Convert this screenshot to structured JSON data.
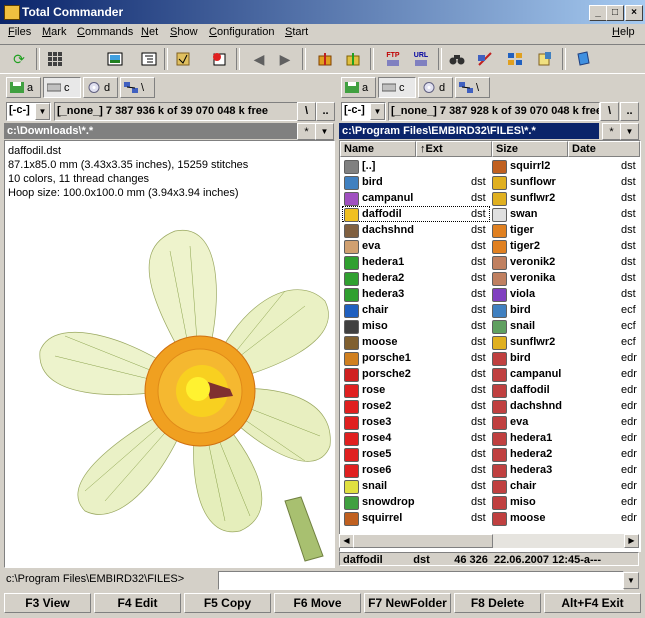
{
  "window": {
    "title": "Total Commander",
    "controls": {
      "minimize": "_",
      "maximize": "□",
      "close": "×"
    }
  },
  "menu": {
    "items": [
      "Files",
      "Mark",
      "Commands",
      "Net",
      "Show",
      "Configuration",
      "Start"
    ],
    "help": "Help"
  },
  "toolbar": {
    "icons": [
      "refresh-icon",
      "thumbnails-icon",
      "image-icon",
      "tree-icon",
      "invert-selection-icon",
      "compare-icon",
      "back-icon",
      "forward-icon",
      "pack-icon",
      "unpack-icon",
      "ftp-icon",
      "url-icon",
      "find-icon",
      "rename-icon",
      "sync-icon",
      "edit-icon",
      "notes-icon"
    ],
    "ftp_label": "FTP",
    "url_label": "URL"
  },
  "left": {
    "drives": [
      "a",
      "c",
      "d",
      "\\"
    ],
    "combo": "[-c-]",
    "free": "[_none_]  7 387 936 k of 39 070 048 k free",
    "root_btn": "\\",
    "up_btn": "..",
    "path": "c:\\Downloads\\*.*",
    "star": "*",
    "viewer": {
      "lines": [
        "daffodil.dst",
        "87.1x85.0 mm (3.43x3.35 inches), 15259 stitches",
        "10 colors, 11 thread changes",
        "Hoop size: 100.0x100.0 mm (3.94x3.94 inches)"
      ]
    }
  },
  "right": {
    "drives": [
      "a",
      "c",
      "d",
      "\\"
    ],
    "combo": "[-c-]",
    "free": "[_none_]  7 387 928 k of 39 070 048 k free",
    "root_btn": "\\",
    "up_btn": "..",
    "path": "c:\\Program Files\\EMBIRD32\\FILES\\*.*",
    "star": "*",
    "columns": {
      "name": "Name",
      "ext": "↑Ext",
      "size": "Size",
      "date": "Date"
    },
    "col1": [
      {
        "name": "[..]",
        "ext": "",
        "color": "#808080"
      },
      {
        "name": "bird",
        "ext": "dst",
        "color": "#4080c0"
      },
      {
        "name": "campanul",
        "ext": "dst",
        "color": "#a050c0"
      },
      {
        "name": "daffodil",
        "ext": "dst",
        "color": "#f0c020"
      },
      {
        "name": "dachshnd",
        "ext": "dst",
        "color": "#806040"
      },
      {
        "name": "eva",
        "ext": "dst",
        "color": "#d0a070"
      },
      {
        "name": "hedera1",
        "ext": "dst",
        "color": "#30a030"
      },
      {
        "name": "hedera2",
        "ext": "dst",
        "color": "#30a030"
      },
      {
        "name": "hedera3",
        "ext": "dst",
        "color": "#30a030"
      },
      {
        "name": "chair",
        "ext": "dst",
        "color": "#2060c0"
      },
      {
        "name": "miso",
        "ext": "dst",
        "color": "#404040"
      },
      {
        "name": "moose",
        "ext": "dst",
        "color": "#806030"
      },
      {
        "name": "porsche1",
        "ext": "dst",
        "color": "#d08020"
      },
      {
        "name": "porsche2",
        "ext": "dst",
        "color": "#d02020"
      },
      {
        "name": "rose",
        "ext": "dst",
        "color": "#e02020"
      },
      {
        "name": "rose2",
        "ext": "dst",
        "color": "#e02020"
      },
      {
        "name": "rose3",
        "ext": "dst",
        "color": "#e02020"
      },
      {
        "name": "rose4",
        "ext": "dst",
        "color": "#e02020"
      },
      {
        "name": "rose5",
        "ext": "dst",
        "color": "#e02020"
      },
      {
        "name": "rose6",
        "ext": "dst",
        "color": "#e02020"
      },
      {
        "name": "snail",
        "ext": "dst",
        "color": "#e0e040"
      },
      {
        "name": "snowdrop",
        "ext": "dst",
        "color": "#40a040"
      },
      {
        "name": "squirrel",
        "ext": "dst",
        "color": "#c06020"
      }
    ],
    "col2": [
      {
        "name": "squirrl2",
        "ext": "dst",
        "color": "#c06020"
      },
      {
        "name": "sunflowr",
        "ext": "dst",
        "color": "#e0b020"
      },
      {
        "name": "sunflwr2",
        "ext": "dst",
        "color": "#e0b020"
      },
      {
        "name": "swan",
        "ext": "dst",
        "color": "#e0e0e0"
      },
      {
        "name": "tiger",
        "ext": "dst",
        "color": "#e08020"
      },
      {
        "name": "tiger2",
        "ext": "dst",
        "color": "#e08020"
      },
      {
        "name": "veronik2",
        "ext": "dst",
        "color": "#c08060"
      },
      {
        "name": "veronika",
        "ext": "dst",
        "color": "#c08060"
      },
      {
        "name": "viola",
        "ext": "dst",
        "color": "#8040c0"
      },
      {
        "name": "bird",
        "ext": "ecf",
        "color": "#4080c0"
      },
      {
        "name": "snail",
        "ext": "ecf",
        "color": "#60a060"
      },
      {
        "name": "sunflwr2",
        "ext": "ecf",
        "color": "#e0b020"
      },
      {
        "name": "bird",
        "ext": "edr",
        "color": "#c04040"
      },
      {
        "name": "campanul",
        "ext": "edr",
        "color": "#c04040"
      },
      {
        "name": "daffodil",
        "ext": "edr",
        "color": "#c04040"
      },
      {
        "name": "dachshnd",
        "ext": "edr",
        "color": "#c04040"
      },
      {
        "name": "eva",
        "ext": "edr",
        "color": "#c04040"
      },
      {
        "name": "hedera1",
        "ext": "edr",
        "color": "#c04040"
      },
      {
        "name": "hedera2",
        "ext": "edr",
        "color": "#c04040"
      },
      {
        "name": "hedera3",
        "ext": "edr",
        "color": "#c04040"
      },
      {
        "name": "chair",
        "ext": "edr",
        "color": "#c04040"
      },
      {
        "name": "miso",
        "ext": "edr",
        "color": "#c04040"
      },
      {
        "name": "moose",
        "ext": "edr",
        "color": "#c04040"
      }
    ],
    "status": "daffodil          dst        46 326  22.06.2007 12:45-a---"
  },
  "cmdline": {
    "label": "c:\\Program Files\\EMBIRD32\\FILES>",
    "value": ""
  },
  "fkeys": [
    "F3 View",
    "F4 Edit",
    "F5 Copy",
    "F6 Move",
    "F7 NewFolder",
    "F8 Delete",
    "Alt+F4 Exit"
  ]
}
